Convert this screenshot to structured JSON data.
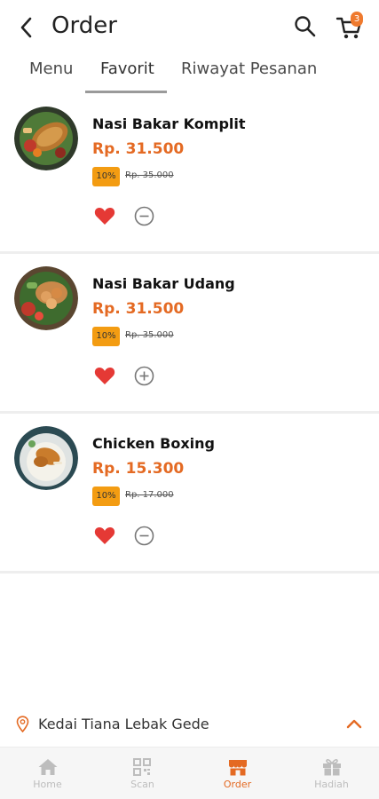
{
  "header": {
    "title": "Order",
    "cart_count": "3"
  },
  "tabs": [
    {
      "label": "Menu",
      "active": false
    },
    {
      "label": "Favorit",
      "active": true
    },
    {
      "label": "Riwayat Pesanan",
      "active": false
    }
  ],
  "items": [
    {
      "name": "Nasi Bakar Komplit",
      "price": "Rp. 31.500",
      "discount": "10%",
      "old_price": "Rp. 35.000",
      "favorite": true,
      "qty_action": "minus-icon"
    },
    {
      "name": "Nasi Bakar Udang",
      "price": "Rp. 31.500",
      "discount": "10%",
      "old_price": "Rp. 35.000",
      "favorite": true,
      "qty_action": "plus-icon"
    },
    {
      "name": "Chicken Boxing",
      "price": "Rp. 15.300",
      "discount": "10%",
      "old_price": "Rp. 17.000",
      "favorite": true,
      "qty_action": "minus-icon"
    }
  ],
  "store": {
    "name": "Kedai Tiana Lebak Gede"
  },
  "bottom_nav": [
    {
      "label": "Home",
      "icon": "home-icon",
      "active": false
    },
    {
      "label": "Scan",
      "icon": "qr-code-icon",
      "active": false
    },
    {
      "label": "Order",
      "icon": "store-icon",
      "active": true
    },
    {
      "label": "Hadiah",
      "icon": "gift-icon",
      "active": false
    }
  ],
  "colors": {
    "accent": "#e46a23",
    "badge": "#f39c12",
    "heart": "#e53935",
    "nav_inactive": "#bdbdbd"
  }
}
